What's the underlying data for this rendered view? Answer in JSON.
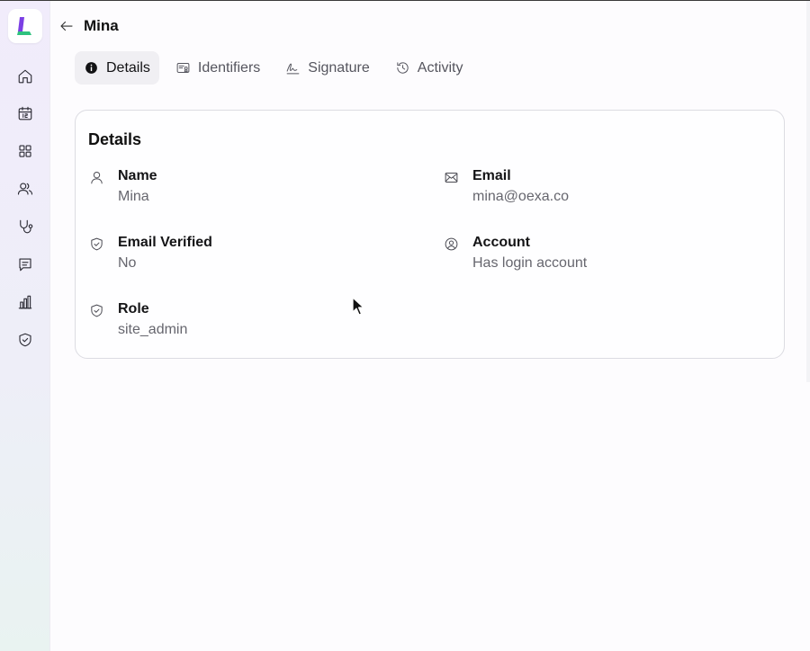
{
  "header": {
    "title": "Mina"
  },
  "tabs": [
    {
      "label": "Details",
      "icon": "info-icon",
      "active": true
    },
    {
      "label": "Identifiers",
      "icon": "id-card-icon",
      "active": false
    },
    {
      "label": "Signature",
      "icon": "signature-icon",
      "active": false
    },
    {
      "label": "Activity",
      "icon": "history-icon",
      "active": false
    }
  ],
  "sidebar": {
    "items": [
      {
        "icon": "home-icon"
      },
      {
        "icon": "calendar-icon"
      },
      {
        "icon": "grid-icon"
      },
      {
        "icon": "users-icon"
      },
      {
        "icon": "stethoscope-icon"
      },
      {
        "icon": "message-icon"
      },
      {
        "icon": "bar-chart-icon"
      },
      {
        "icon": "shield-icon"
      }
    ]
  },
  "card": {
    "title": "Details",
    "fields": [
      {
        "label": "Name",
        "value": "Mina",
        "icon": "user-icon"
      },
      {
        "label": "Email",
        "value": "mina@oexa.co",
        "icon": "mail-icon"
      },
      {
        "label": "Email Verified",
        "value": "No",
        "icon": "shield-check-icon"
      },
      {
        "label": "Account",
        "value": "Has login account",
        "icon": "user-circle-icon"
      },
      {
        "label": "Role",
        "value": "site_admin",
        "icon": "shield-check-icon"
      }
    ]
  },
  "colors": {
    "logo_purple": "#7b3fe4",
    "logo_green": "#2ec27e",
    "text_primary": "#141416",
    "text_secondary": "#66666e",
    "active_tab_bg": "#f0eff3"
  }
}
